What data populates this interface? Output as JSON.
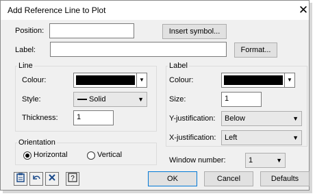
{
  "window": {
    "title": "Add Reference Line to Plot"
  },
  "position": {
    "label": "Position:",
    "value": ""
  },
  "insert_symbol": "Insert symbol...",
  "label_field": {
    "label": "Label:",
    "value": ""
  },
  "format_button": "Format...",
  "line_group": {
    "title": "Line",
    "colour_label": "Colour:",
    "style_label": "Style:",
    "style_value": "Solid",
    "thickness_label": "Thickness:",
    "thickness_value": "1"
  },
  "label_group": {
    "title": "Label",
    "colour_label": "Colour:",
    "size_label": "Size:",
    "size_value": "1",
    "yjust_label": "Y-justification:",
    "yjust_value": "Below",
    "xjust_label": "X-justification:",
    "xjust_value": "Left"
  },
  "orientation": {
    "title": "Orientation",
    "horizontal": "Horizontal",
    "vertical": "Vertical",
    "selected": "Horizontal"
  },
  "window_number": {
    "label": "Window number:",
    "value": "1"
  },
  "buttons": {
    "ok": "OK",
    "cancel": "Cancel",
    "defaults": "Defaults"
  },
  "colors": {
    "colour_swatch": "#000000"
  },
  "icons": [
    "paste-icon",
    "undo-icon",
    "clear-icon",
    "help-icon"
  ]
}
